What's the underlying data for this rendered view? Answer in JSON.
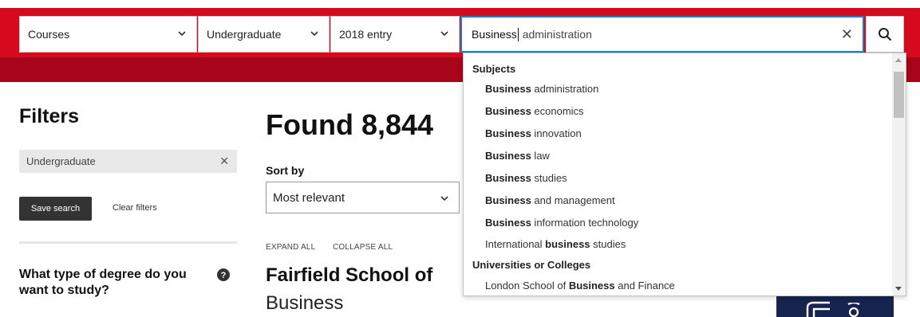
{
  "search_bar": {
    "course_type": "Courses",
    "study_level": "Undergraduate",
    "entry_year": "2018 entry",
    "query_typed": "Business",
    "query_suggestion_rest": " administration",
    "clear_icon": "close-icon",
    "search_icon": "search-icon"
  },
  "autocomplete": {
    "groups": [
      {
        "label": "Subjects",
        "items": [
          {
            "pre": "",
            "bold": "Business",
            "post": " administration"
          },
          {
            "pre": "",
            "bold": "Business",
            "post": " economics"
          },
          {
            "pre": "",
            "bold": "Business",
            "post": " innovation"
          },
          {
            "pre": "",
            "bold": "Business",
            "post": " law"
          },
          {
            "pre": "",
            "bold": "Business",
            "post": " studies"
          },
          {
            "pre": "",
            "bold": "Business",
            "post": " and management"
          },
          {
            "pre": "",
            "bold": "Business",
            "post": " information technology"
          },
          {
            "pre": "International ",
            "bold": "business",
            "post": " studies"
          }
        ]
      },
      {
        "label": "Universities or Colleges",
        "items": [
          {
            "pre": "London School of ",
            "bold": "Business",
            "post": " and Finance"
          }
        ]
      }
    ]
  },
  "filters": {
    "title": "Filters",
    "active_chip": "Undergraduate",
    "save_label": "Save search",
    "clear_label": "Clear filters",
    "question": "What type of degree do you want to study?",
    "help_icon": "question-circle-icon"
  },
  "results": {
    "found_text": "Found 8,844",
    "sort_label": "Sort by",
    "sort_value": "Most relevant",
    "expand_all": "EXPAND ALL",
    "collapse_all": "COLLAPSE ALL",
    "first_result_title": "Fairfield School of",
    "first_result_subtitle": "Business"
  },
  "colors": {
    "brand_red": "#d50a1e",
    "brand_dark_red": "#a8051a",
    "focus_blue": "#1a7fd1",
    "ad_navy": "#16244f"
  }
}
